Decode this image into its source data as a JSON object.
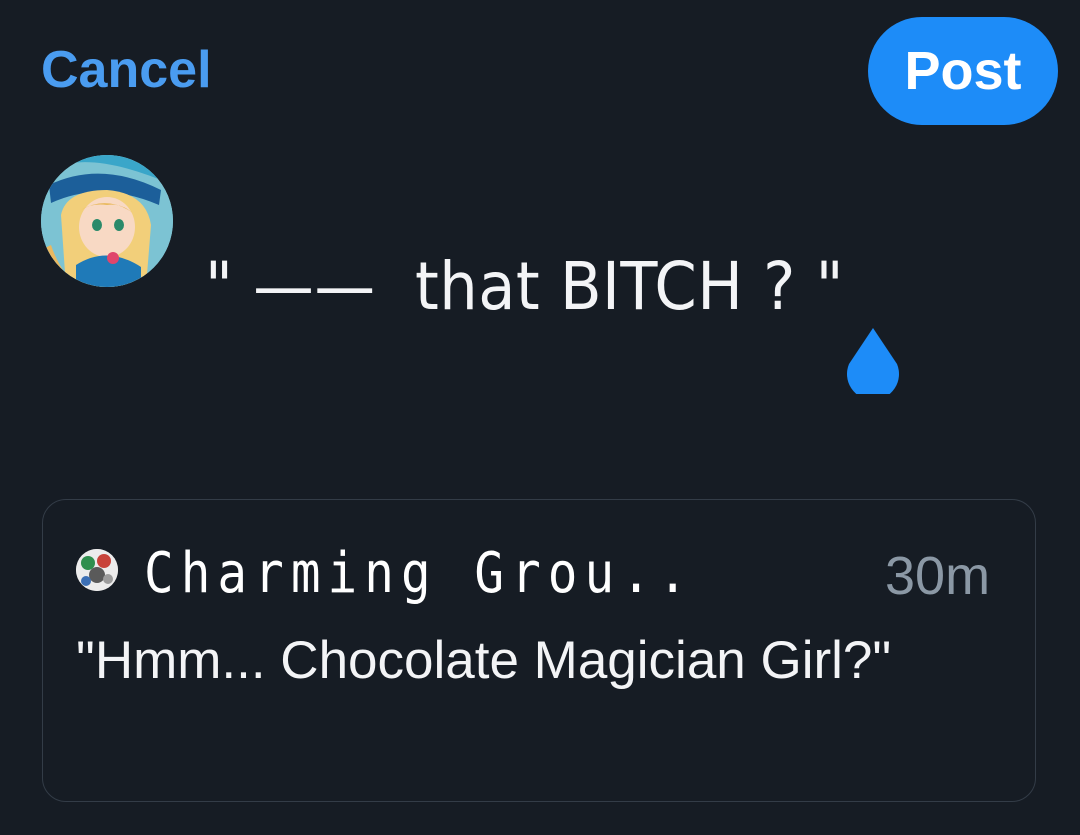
{
  "header": {
    "cancel_label": "Cancel",
    "post_label": "Post"
  },
  "composer": {
    "text": "\" ——  that BITCH ? \""
  },
  "quoted_post": {
    "display_name": "Charming Grou..",
    "time": "30m",
    "text": "\"Hmm... Chocolate Magician Girl?\""
  },
  "colors": {
    "background": "#161c24",
    "accent": "#1d8cf8",
    "link": "#4a9cf0",
    "muted": "#8b98a5",
    "border": "#333c47"
  }
}
